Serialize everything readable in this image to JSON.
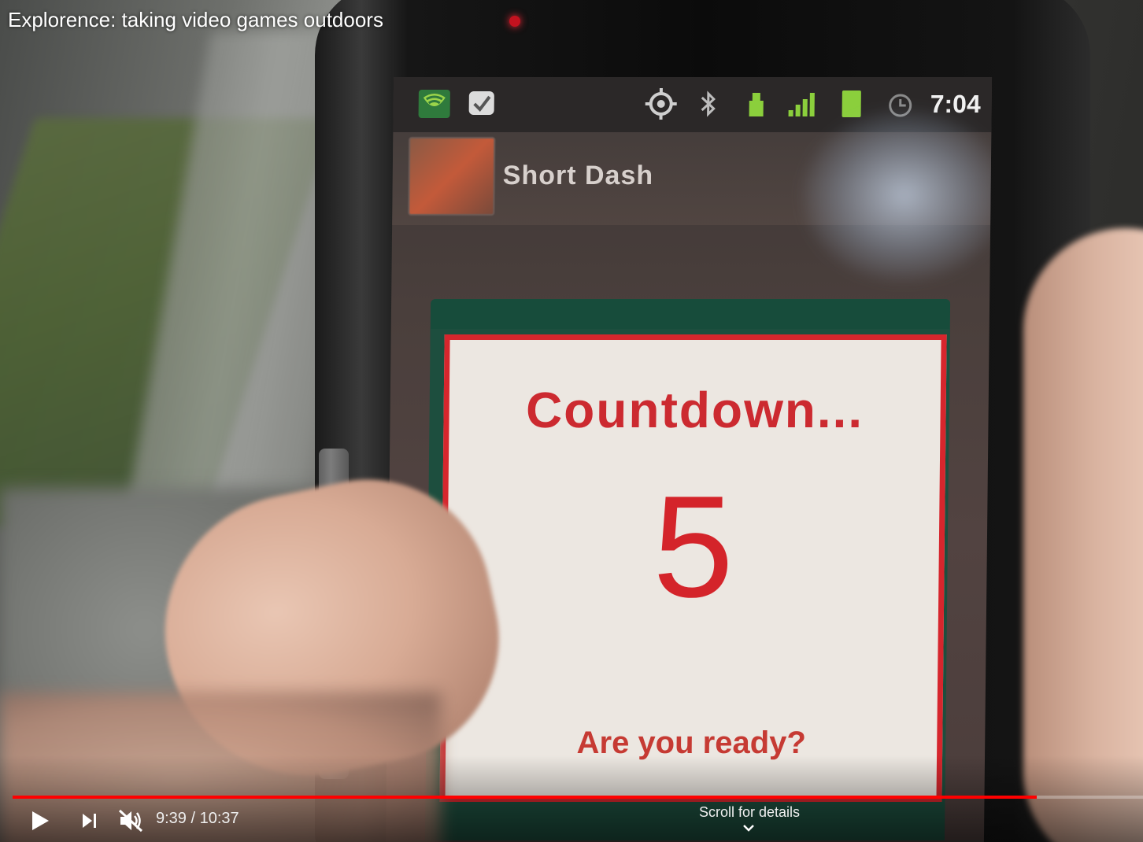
{
  "video": {
    "title": "Explorence: taking video games outdoors",
    "current_time": "9:39",
    "duration": "10:37",
    "time_display": "9:39 / 10:37",
    "progress_fraction": 0.906,
    "muted": true
  },
  "controls": {
    "play_icon": "play-icon",
    "next_icon": "next-icon",
    "volume_icon": "volume-muted-icon",
    "scroll_hint": "Scroll for details",
    "scroll_icon": "chevron-down-icon"
  },
  "phone": {
    "status_bar": {
      "time": "7:04",
      "icons": [
        "shield-notification-icon",
        "check-notification-icon",
        "gps-icon",
        "bluetooth-icon",
        "usb-icon",
        "signal-icon",
        "battery-icon",
        "alarm-icon"
      ]
    },
    "app": {
      "title": "Short Dash"
    },
    "dialog": {
      "title": "Countdown...",
      "count": "5",
      "subtitle": "Are you ready?"
    }
  },
  "colors": {
    "accent_red": "#d4242a",
    "dialog_green": "#174c3b",
    "progress_red": "#ff0000"
  }
}
